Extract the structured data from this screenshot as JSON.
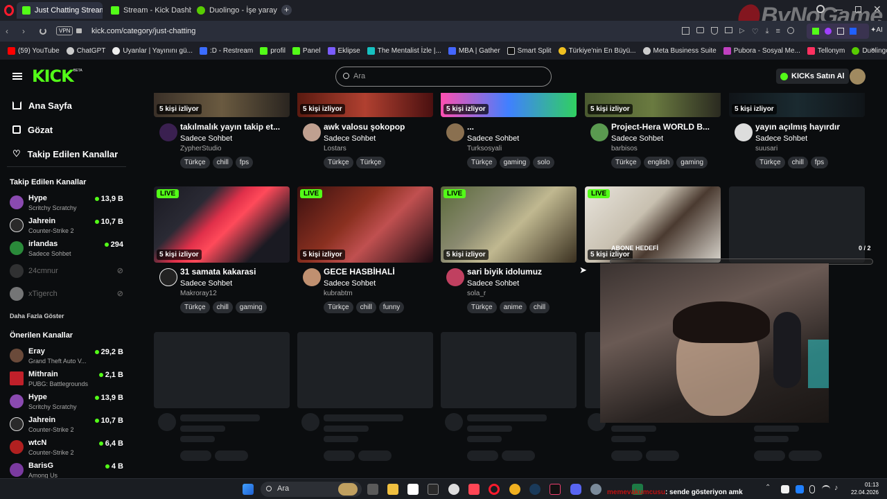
{
  "browser": {
    "tabs": [
      {
        "label": "Just Chatting Streaming -",
        "active": true
      },
      {
        "label": "Stream - Kick Dashboard",
        "active": false
      },
      {
        "label": "Duolingo - İşe yarayan de",
        "active": false
      }
    ],
    "vpn": "VPN",
    "url": "kick.com/category/just-chatting",
    "ai_label": "AI",
    "bookmarks": [
      "(59) YouTube",
      "ChatGPT",
      "Uyanlar | Yayınını gü...",
      ":D - Restream",
      "profil",
      "Panel",
      "Eklipse",
      "The Mentalist İzle |...",
      "MBA | Gather",
      "Smart Split",
      "Türkiye'nin En Büyü...",
      "Meta Business Suite",
      "Pubora - Sosyal Me...",
      "Tellonym",
      "Duolingo - İşe yaray..."
    ]
  },
  "watermark": "ByNoGame",
  "kick": {
    "logo": "KICK",
    "beta": "BETA",
    "search_placeholder": "Ara",
    "buy_kicks": "KICKs Satın Al",
    "nav": [
      "Ana Sayfa",
      "Gözat",
      "Takip Edilen Kanallar"
    ],
    "followed_title": "Takip Edilen Kanallar",
    "followed": [
      {
        "name": "Hype",
        "category": "Scritchy Scratchy",
        "viewers": "13,9 B"
      },
      {
        "name": "Jahrein",
        "category": "Counter-Strike 2",
        "viewers": "10,7 B"
      },
      {
        "name": "irlandas",
        "category": "Sadece Sohbet",
        "viewers": "294"
      },
      {
        "name": "24cmnur",
        "category": "",
        "viewers": ""
      },
      {
        "name": "xTigerch",
        "category": "",
        "viewers": ""
      }
    ],
    "show_more": "Daha Fazla Göster",
    "recommended_title": "Önerilen Kanallar",
    "recommended": [
      {
        "name": "Eray",
        "category": "Grand Theft Auto V...",
        "viewers": "29,2 B"
      },
      {
        "name": "Mithrain",
        "category": "PUBG: Battlegrounds",
        "viewers": "2,1 B"
      },
      {
        "name": "Hype",
        "category": "Scritchy Scratchy",
        "viewers": "13,9 B"
      },
      {
        "name": "Jahrein",
        "category": "Counter-Strike 2",
        "viewers": "10,7 B"
      },
      {
        "name": "wtcN",
        "category": "Counter-Strike 2",
        "viewers": "6,4 B"
      },
      {
        "name": "BarisG",
        "category": "Among Us",
        "viewers": "4 B"
      }
    ],
    "row1": [
      {
        "viewers": "5 kişi izliyor",
        "title": "takılmalık yayın takip et...",
        "category": "Sadece Sohbet",
        "user": "ZypherStudio",
        "tags": [
          "Türkçe",
          "chill",
          "fps"
        ]
      },
      {
        "viewers": "5 kişi izliyor",
        "title": "awk valosu şokopop",
        "category": "Sadece Sohbet",
        "user": "Lostars",
        "tags": [
          "Türkçe",
          "Türkçe"
        ]
      },
      {
        "viewers": "5 kişi izliyor",
        "title": "...",
        "category": "Sadece Sohbet",
        "user": "Turksosyali",
        "tags": [
          "Türkçe",
          "gaming",
          "solo"
        ]
      },
      {
        "viewers": "5 kişi izliyor",
        "title": "Project-Hera WORLD B...",
        "category": "Sadece Sohbet",
        "user": "barbisos",
        "tags": [
          "Türkçe",
          "english",
          "gaming"
        ]
      },
      {
        "viewers": "5 kişi izliyor",
        "title": "yayın açılmış hayırdır",
        "category": "Sadece Sohbet",
        "user": "suusari",
        "tags": [
          "Türkçe",
          "chill",
          "fps"
        ]
      }
    ],
    "row2": [
      {
        "live": "LIVE",
        "viewers": "5 kişi izliyor",
        "title": "31 samata kakarasi",
        "category": "Sadece Sohbet",
        "user": "Makroray12",
        "tags": [
          "Türkçe",
          "chill",
          "gaming"
        ]
      },
      {
        "live": "LIVE",
        "viewers": "5 kişi izliyor",
        "title": "GECE HASBİHALİ",
        "category": "Sadece Sohbet",
        "user": "kubrabtm",
        "tags": [
          "Türkçe",
          "chill",
          "funny"
        ]
      },
      {
        "live": "LIVE",
        "viewers": "5 kişi izliyor",
        "title": "sari biyik idolumuz",
        "category": "Sadece Sohbet",
        "user": "sola_r",
        "tags": [
          "Türkçe",
          "anime",
          "chill"
        ]
      },
      {
        "live": "LIVE",
        "viewers": "5 kişi izliyor"
      }
    ],
    "overlay_goal_label": "ABONE HEDEFİ",
    "overlay_goal_count": "0 / 2",
    "overlay_goal_progress": 0
  },
  "taskbar": {
    "search": "Ara",
    "chat_user": "memevakumcusu",
    "chat_msg": ": sende gösteriyon amk",
    "time": "01:13",
    "date": "22.04.2026"
  }
}
